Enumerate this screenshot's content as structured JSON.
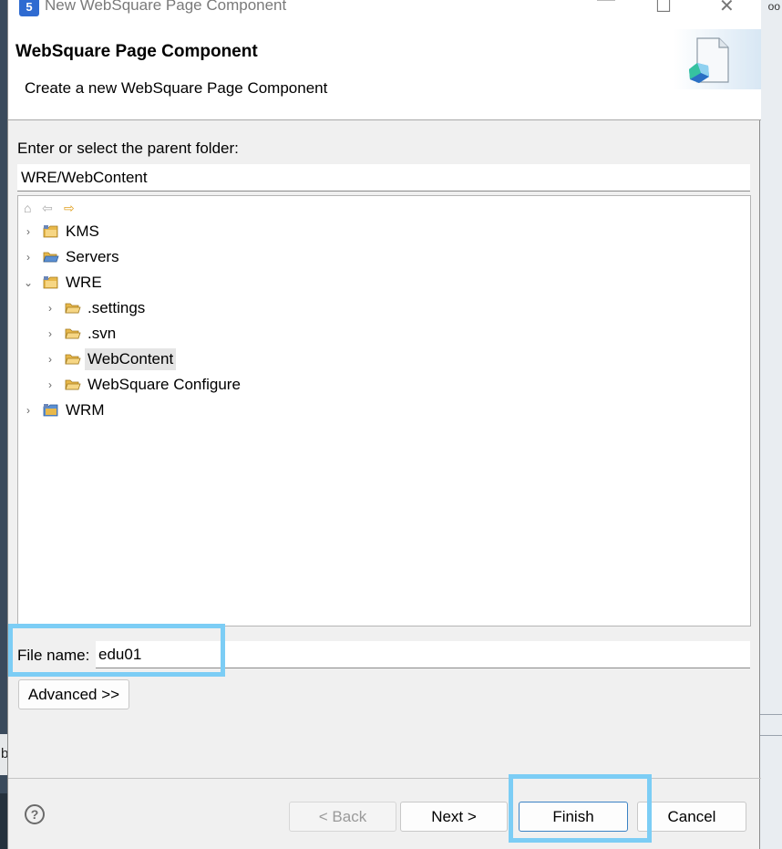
{
  "window": {
    "title": "New WebSquare Page Component",
    "app_icon_text": "5",
    "minimize": "—",
    "maximize": "☐",
    "close": "✕"
  },
  "header": {
    "title": "WebSquare Page Component",
    "description": "Create a new WebSquare Page Component"
  },
  "folder": {
    "label": "Enter or select the parent folder:",
    "value": "WRE/WebContent"
  },
  "tree_toolbar": {
    "home_icon": "⌂",
    "back_icon": "⇦",
    "forward_icon": "⇨"
  },
  "tree": [
    {
      "label": "KMS",
      "chevron": "›",
      "icon": "project-folder-icon",
      "depth": 0,
      "selected": false
    },
    {
      "label": "Servers",
      "chevron": "›",
      "icon": "open-folder-icon",
      "depth": 0,
      "selected": false
    },
    {
      "label": "WRE",
      "chevron": "⌄",
      "icon": "project-folder-icon",
      "depth": 0,
      "selected": false
    },
    {
      "label": ".settings",
      "chevron": "›",
      "icon": "folder-icon",
      "depth": 1,
      "selected": false
    },
    {
      "label": ".svn",
      "chevron": "›",
      "icon": "folder-icon",
      "depth": 1,
      "selected": false
    },
    {
      "label": "WebContent",
      "chevron": "›",
      "icon": "folder-icon",
      "depth": 1,
      "selected": true
    },
    {
      "label": "WebSquare Configure",
      "chevron": "›",
      "icon": "folder-icon",
      "depth": 1,
      "selected": false
    },
    {
      "label": "WRM",
      "chevron": "›",
      "icon": "java-project-icon",
      "depth": 0,
      "selected": false
    }
  ],
  "file_name": {
    "label": "File name:",
    "value": "edu01"
  },
  "buttons": {
    "advanced": "Advanced >>",
    "help": "?",
    "back": "< Back",
    "next": "Next >",
    "finish": "Finish",
    "cancel": "Cancel"
  },
  "background": {
    "right_edge_text": "oo",
    "left_edge_text": "b"
  },
  "colors": {
    "highlight": "#7ccdf5",
    "folder": "#e8b84a",
    "selection": "#e5e5e5",
    "default_button_border": "#3b82c4"
  }
}
